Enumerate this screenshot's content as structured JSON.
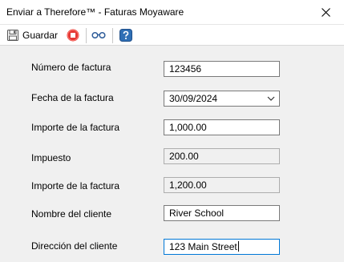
{
  "window": {
    "title": "Enviar a Therefore™ - Faturas Moyaware"
  },
  "toolbar": {
    "save_label": "Guardar"
  },
  "form": {
    "invoice_number": {
      "label": "Número de factura",
      "value": "123456"
    },
    "invoice_date": {
      "label": "Fecha de la factura",
      "value": "30/09/2024"
    },
    "invoice_amount": {
      "label": "Importe de la factura",
      "value": "1,000.00"
    },
    "tax": {
      "label": "Impuesto",
      "value": "200.00"
    },
    "invoice_total": {
      "label": "Importe de la factura",
      "value": "1,200.00"
    },
    "customer_name": {
      "label": "Nombre del cliente",
      "value": "River School"
    },
    "customer_address": {
      "label": "Dirección del cliente",
      "value": "123 Main Street"
    }
  },
  "colors": {
    "accent": "#0078d7",
    "stop_red": "#e53935",
    "help_blue": "#2f6fb5"
  }
}
